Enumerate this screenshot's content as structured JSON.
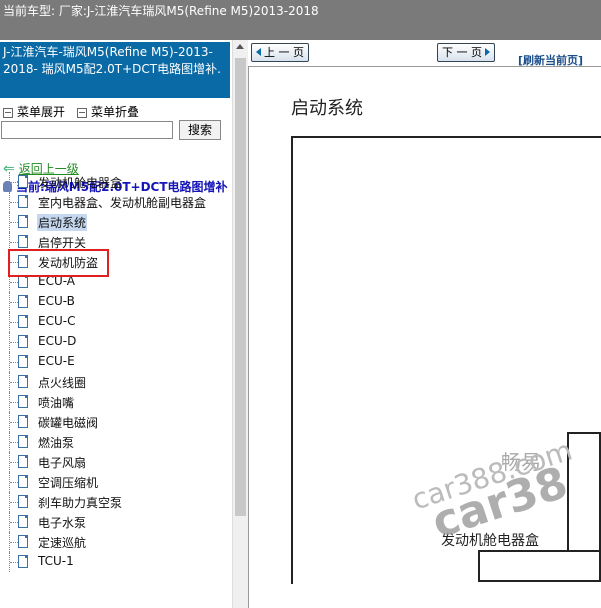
{
  "top_bar": {
    "text": "当前车型:   厂家:J-江淮汽车瑞风M5(Refine M5)2013-2018"
  },
  "sidebar": {
    "vehicle_title": "J-江淮汽车-瑞风M5(Refine M5)-2013-2018- 瑞风M5配2.0T+DCT电路图增补.",
    "menu_expand": "菜单展开",
    "menu_collapse": "菜单折叠",
    "search_value": "",
    "search_button": "搜索",
    "back_link": "返回上一级",
    "current_label": "当前:瑞风M5配2.0T+DCT电路图增补",
    "tree": [
      {
        "label": "发动机舱电器盒"
      },
      {
        "label": "室内电器盒、发动机舱副电器盒"
      },
      {
        "label": "启动系统",
        "selected": true
      },
      {
        "label": "启停开关"
      },
      {
        "label": "发动机防盗"
      },
      {
        "label": "ECU-A"
      },
      {
        "label": "ECU-B"
      },
      {
        "label": "ECU-C"
      },
      {
        "label": "ECU-D"
      },
      {
        "label": "ECU-E"
      },
      {
        "label": "点火线圈"
      },
      {
        "label": "喷油嘴"
      },
      {
        "label": "碳罐电磁阀"
      },
      {
        "label": "燃油泵"
      },
      {
        "label": "电子风扇"
      },
      {
        "label": "空调压缩机"
      },
      {
        "label": "刹车助力真空泵"
      },
      {
        "label": "电子水泵"
      },
      {
        "label": "定速巡航"
      },
      {
        "label": "TCU-1"
      }
    ]
  },
  "viewer": {
    "prev_button": "上 一 页",
    "next_button": "下 一 页",
    "refresh_link": "[刷新当前页]",
    "page_title": "启动系统",
    "diagram_label": "发动机舱电器盒",
    "watermark_cn": "畅易",
    "watermark_url": "car388.com",
    "watermark_big": "car38"
  },
  "colors": {
    "header_blue": "#0a6aa6",
    "highlight_red": "#e02020",
    "link_green": "#228b22",
    "current_blue": "#1515b8"
  }
}
